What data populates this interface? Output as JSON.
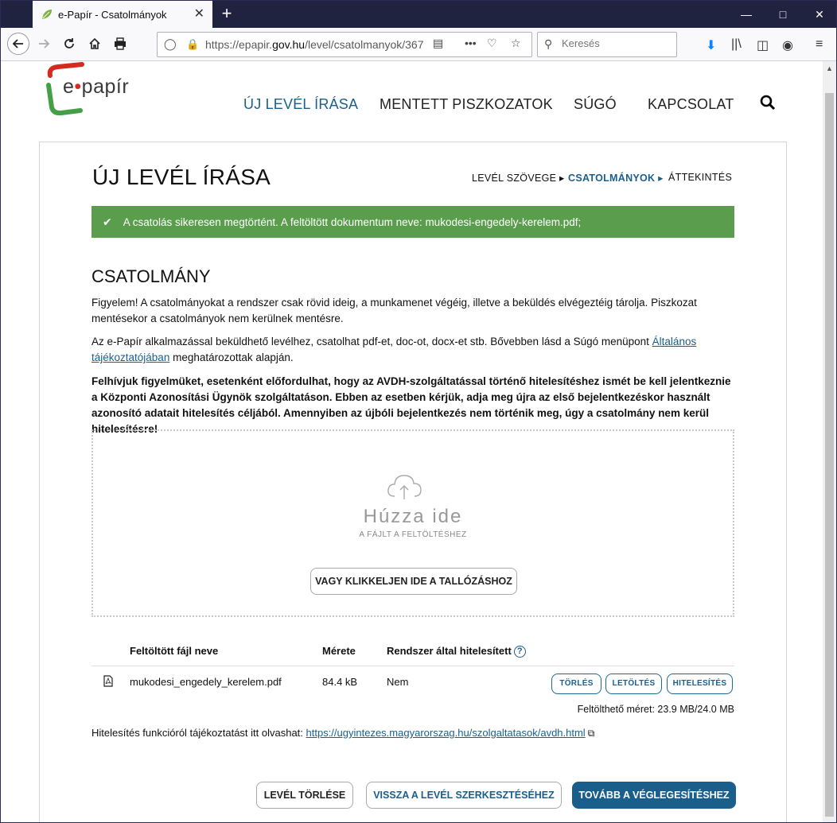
{
  "browser": {
    "tab_title": "e-Papír - Csatolmányok",
    "tab_close": "✕",
    "new_tab": "+",
    "url_prefix": "https://epapir.",
    "url_domain": "gov.hu",
    "url_path": "/level/csatolmanyok/367",
    "search_placeholder": "Keresés"
  },
  "site": {
    "logo_prefix": "e",
    "logo_dot": "•",
    "logo_suffix": "papír",
    "nav": [
      "ÚJ LEVÉL ÍRÁSA",
      "MENTETT PISZKOZATOK",
      "SÚGÓ",
      "KAPCSOLAT"
    ]
  },
  "page": {
    "title": "ÚJ LEVÉL ÍRÁSA",
    "steps": [
      "LEVÉL SZÖVEGE",
      "CSATOLMÁNYOK",
      "ÁTTEKINTÉS"
    ],
    "alert": "A csatolás sikeresen megtörtént. A feltöltött dokumentum neve: mukodesi-engedely-kerelem.pdf;",
    "section_title": "CSATOLMÁNY",
    "para1": "Figyelem! A csatolmányokat a rendszer csak rövid ideig, a munkamenet végéig, illetve a beküldés elvégeztéig tárolja. Piszkozat mentésekor a csatolmányok nem kerülnek mentésre.",
    "para2_a": "Az e-Papír alkalmazással beküldhető levélhez, csatolhat pdf-et, doc-ot, docx-et stb. Bővebben lásd a Súgó menüpont ",
    "para2_link": "Általános tájékoztatójában",
    "para2_b": " meghatározottak alapján.",
    "para3": "Felhívjuk figyelmüket, esetenként előfordulhat, hogy az AVDH-szolgáltatással történő hitelesítéshez ismét be kell jelentkeznie a Központi Azonosítási Ügynök szolgáltatáson. Ebben az esetben kérjük, adja meg újra az első bejelentkezéskor használt azonosító adatait hitelesítés céljából. Amennyiben az újbóli bejelentkezés nem történik meg, úgy a csatolmány nem kerül hitelesítésre!",
    "drop_main": "Húzza ide",
    "drop_sub": "A FÁJLT A FELTÖLTÉSHEZ",
    "browse_button": "VAGY KLIKKELJEN IDE A TALLÓZÁSHOZ",
    "table": {
      "headers": [
        "Feltöltött fájl neve",
        "Mérete",
        "Rendszer által hitelesített"
      ],
      "help": "?",
      "rows": [
        {
          "name": "mukodesi_engedely_kerelem.pdf",
          "size": "84.4 kB",
          "verified": "Nem"
        }
      ],
      "row_actions": [
        "TÖRLÉS",
        "LETÖLTÉS",
        "HITELESÍTÉS"
      ]
    },
    "quota": "Feltölthető méret: 23.9 MB/24.0 MB",
    "info_text": "Hitelesítés funkcióról tájékoztatást itt olvashat: ",
    "info_link": "https://ugyintezes.magyarorszag.hu/szolgaltatasok/avdh.html",
    "buttons": {
      "delete_letter": "LEVÉL TÖRLÉSE",
      "back_to_edit": "VISSZA A LEVÉL SZERKESZTÉSÉHEZ",
      "next": "TOVÁBB A VÉGLEGESÍTÉSHEZ"
    }
  },
  "colors": {
    "accent": "#1a5f8c",
    "success": "#5a9e4d",
    "titlebar": "#202340"
  }
}
